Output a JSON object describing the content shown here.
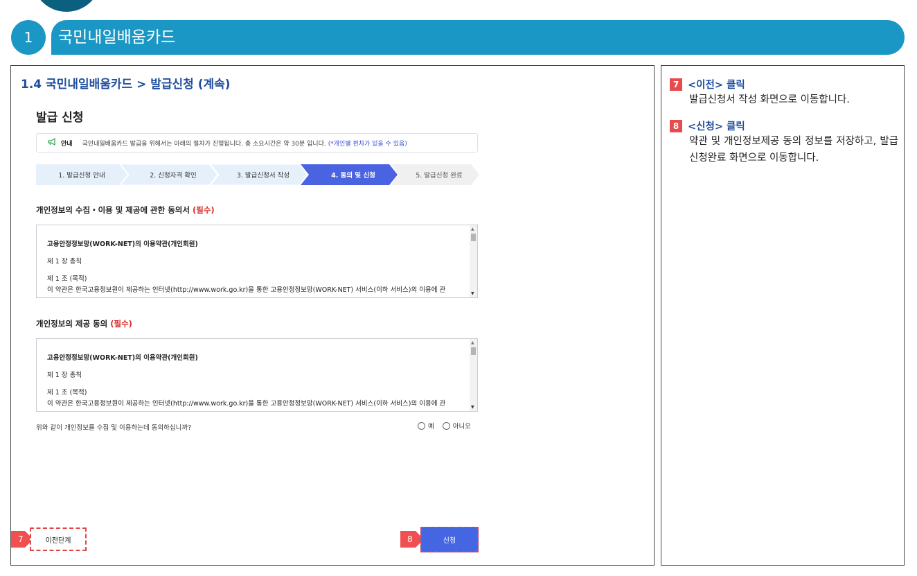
{
  "chapter": {
    "number": "1",
    "title": "국민내일배움카드"
  },
  "section_title": "1.4 국민내일배움카드 > 발급신청 (계속)",
  "page_heading": "발급 신청",
  "notice": {
    "label": "안내",
    "text": "국민내일배움카드 발급을 위해서는 아래의 절차가 진행됩니다. 총 소요시간은 약 30분 입니다.",
    "note": "(*개인별 편차가 있을 수 있음)"
  },
  "steps": [
    {
      "label": "1. 발급신청 안내"
    },
    {
      "label": "2. 신청자격 확인"
    },
    {
      "label": "3. 발급신청서 작성"
    },
    {
      "label": "4. 동의 및 신청"
    },
    {
      "label": "5. 발급신청 완료"
    }
  ],
  "active_step": 4,
  "consent1": {
    "title": "개인정보의 수집・이용 및 제공에 관한 동의서",
    "required": "(필수)",
    "lines": [
      "고용안정정보망(WORK-NET)의 이용약관(개인회원)",
      "제 1 장 총칙",
      "제 1 조 (목적)",
      "이 약관은 한국고용정보원이 제공하는 인터넷(http://www.work.go.kr)을 통한 고용안정정보망(WORK-NET) 서비스(이하 서비스)의 이용에 관"
    ]
  },
  "consent2": {
    "title": "개인정보의 제공 동의",
    "required": "(필수)",
    "lines": [
      "고용안정정보망(WORK-NET)의 이용약관(개인회원)",
      "제 1 장 총칙",
      "제 1 조 (목적)",
      "이 약관은 한국고용정보원이 제공하는 인터넷(http://www.work.go.kr)을 통한 고용안정정보망(WORK-NET) 서비스(이하 서비스)의 이용에 관"
    ]
  },
  "question": "위와 같이 개인정보를 수집 및 이용하는데 동의하십니까?",
  "radio_yes": "예",
  "radio_no": "아니오",
  "buttons": {
    "prev": "이전단계",
    "apply": "신청"
  },
  "callouts": {
    "prev": "7",
    "apply": "8"
  },
  "descriptions": [
    {
      "badge": "7",
      "title": "<이전> 클릭",
      "text": "발급신청서 작성 화면으로 이동합니다."
    },
    {
      "badge": "8",
      "title": "<신청> 클릭",
      "text": "약관 및 개인정보제공 동의 정보를 저장하고, 발급신청완료 화면으로 이동합니다."
    }
  ],
  "colors": {
    "chapter_bar": "#1a97c4",
    "active_step": "#4a63e0",
    "step_bg": "#e6f0fb",
    "accent_title": "#1f4e9e",
    "required": "#d82a2a",
    "badge": "#e84b4b"
  }
}
